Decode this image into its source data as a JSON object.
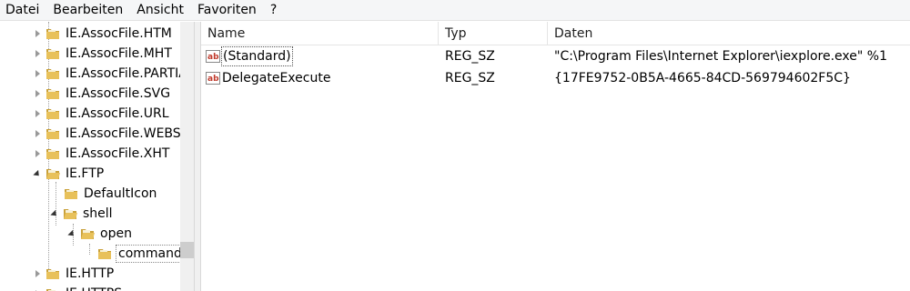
{
  "menu": [
    "Datei",
    "Bearbeiten",
    "Ansicht",
    "Favoriten",
    "?"
  ],
  "tree": [
    {
      "label": "IE.AssocFile.HTM",
      "state": "collapsed"
    },
    {
      "label": "IE.AssocFile.MHT",
      "state": "collapsed"
    },
    {
      "label": "IE.AssocFile.PARTIA",
      "state": "collapsed"
    },
    {
      "label": "IE.AssocFile.SVG",
      "state": "collapsed"
    },
    {
      "label": "IE.AssocFile.URL",
      "state": "collapsed"
    },
    {
      "label": "IE.AssocFile.WEBSIT",
      "state": "collapsed"
    },
    {
      "label": "IE.AssocFile.XHT",
      "state": "collapsed"
    },
    {
      "label": "IE.FTP",
      "state": "expanded"
    },
    {
      "label": "DefaultIcon",
      "state": "leaf"
    },
    {
      "label": "shell",
      "state": "expanded"
    },
    {
      "label": "open",
      "state": "expanded"
    },
    {
      "label": "command",
      "state": "selected"
    },
    {
      "label": "IE.HTTP",
      "state": "collapsed"
    },
    {
      "label": "IE.HTTPS",
      "state": "collapsed"
    }
  ],
  "columns": {
    "name": "Name",
    "type": "Typ",
    "data": "Daten"
  },
  "values": [
    {
      "name": "(Standard)",
      "type": "REG_SZ",
      "data": "\"C:\\Program Files\\Internet Explorer\\iexplore.exe\" %1"
    },
    {
      "name": "DelegateExecute",
      "type": "REG_SZ",
      "data": "{17FE9752-0B5A-4665-84CD-569794602F5C}"
    }
  ],
  "colors": {
    "folder": "#e8c15a",
    "folder_dark": "#c9a13a",
    "ab_red": "#c0392b"
  }
}
